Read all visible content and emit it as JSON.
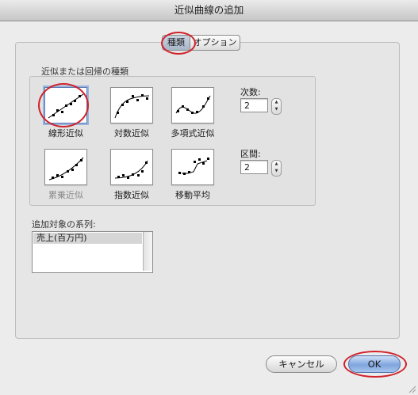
{
  "window": {
    "title": "近似曲線の追加"
  },
  "tabs": [
    {
      "label": "種類",
      "selected": true
    },
    {
      "label": "オプション",
      "selected": false
    }
  ],
  "trend_group": {
    "label": "近似または回帰の種類",
    "types": [
      {
        "label": "線形近似",
        "selected": true,
        "enabled": true,
        "icon": "linear-trend-icon"
      },
      {
        "label": "対数近似",
        "selected": false,
        "enabled": true,
        "icon": "logarithmic-trend-icon"
      },
      {
        "label": "多項式近似",
        "selected": false,
        "enabled": true,
        "icon": "polynomial-trend-icon"
      },
      {
        "label": "累乗近似",
        "selected": false,
        "enabled": false,
        "icon": "power-trend-icon"
      },
      {
        "label": "指数近似",
        "selected": false,
        "enabled": true,
        "icon": "exponential-trend-icon"
      },
      {
        "label": "移動平均",
        "selected": false,
        "enabled": true,
        "icon": "moving-average-icon"
      }
    ],
    "order": {
      "label": "次数:",
      "value": "2"
    },
    "period": {
      "label": "区間:",
      "value": "2"
    }
  },
  "series": {
    "label": "追加対象の系列:",
    "items": [
      "売上(百万円)"
    ],
    "selected": "売上(百万円)"
  },
  "buttons": {
    "cancel": "キャンセル",
    "ok": "OK"
  },
  "colors": {
    "highlight_ring": "#d0222a",
    "default_button": "#7fa6de"
  }
}
